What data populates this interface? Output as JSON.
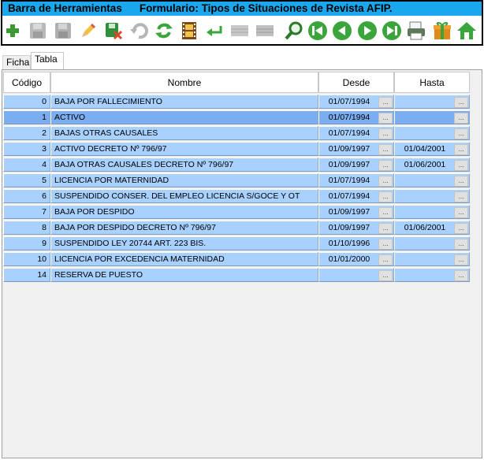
{
  "toolbar": {
    "title": "Barra de Herramientas",
    "form_title": "Formulario: Tipos de Situaciones de Revista AFIP.",
    "buttons": [
      {
        "name": "add-icon"
      },
      {
        "name": "save-icon"
      },
      {
        "name": "save-as-icon"
      },
      {
        "name": "edit-pencil-icon"
      },
      {
        "name": "delete-icon"
      },
      {
        "name": "undo-icon"
      },
      {
        "name": "refresh-icon"
      },
      {
        "name": "film-icon"
      },
      {
        "name": "return-icon"
      },
      {
        "name": "grid-icon-1"
      },
      {
        "name": "grid-icon-2"
      },
      {
        "name": "search-icon"
      },
      {
        "name": "first-record-icon"
      },
      {
        "name": "previous-record-icon"
      },
      {
        "name": "next-record-icon"
      },
      {
        "name": "last-record-icon"
      },
      {
        "name": "print-icon"
      },
      {
        "name": "gift-icon"
      },
      {
        "name": "home-icon"
      }
    ]
  },
  "tabs": [
    {
      "label": "Ficha",
      "active": false
    },
    {
      "label": "Tabla",
      "active": true
    }
  ],
  "table": {
    "columns": [
      "Código",
      "Nombre",
      "Desde",
      "Hasta"
    ],
    "ellipsis": "...",
    "rows": [
      {
        "code": "0",
        "name": "BAJA POR FALLECIMIENTO",
        "desde": "01/07/1994",
        "hasta": ""
      },
      {
        "code": "1",
        "name": "ACTIVO",
        "desde": "01/07/1994",
        "hasta": "",
        "selected": true
      },
      {
        "code": "2",
        "name": "BAJAS OTRAS CAUSALES",
        "desde": "01/07/1994",
        "hasta": ""
      },
      {
        "code": "3",
        "name": "ACTIVO DECRETO Nº 796/97",
        "desde": "01/09/1997",
        "hasta": "01/04/2001"
      },
      {
        "code": "4",
        "name": "BAJA OTRAS CAUSALES DECRETO Nº 796/97",
        "desde": "01/09/1997",
        "hasta": "01/06/2001"
      },
      {
        "code": "5",
        "name": "LICENCIA POR MATERNIDAD",
        "desde": "01/07/1994",
        "hasta": ""
      },
      {
        "code": "6",
        "name": "SUSPENDIDO CONSER. DEL EMPLEO LICENCIA S/GOCE Y OT",
        "desde": "01/07/1994",
        "hasta": ""
      },
      {
        "code": "7",
        "name": "BAJA POR DESPIDO",
        "desde": "01/09/1997",
        "hasta": ""
      },
      {
        "code": "8",
        "name": "BAJA POR DESPIDO DECRETO Nº 796/97",
        "desde": "01/09/1997",
        "hasta": "01/06/2001"
      },
      {
        "code": "9",
        "name": "SUSPENDIDO LEY 20744 ART. 223 BIS.",
        "desde": "01/10/1996",
        "hasta": ""
      },
      {
        "code": "10",
        "name": "LICENCIA POR EXCEDENCIA MATERNIDAD",
        "desde": "01/01/2000",
        "hasta": ""
      },
      {
        "code": "14",
        "name": "RESERVA DE PUESTO",
        "desde": "",
        "hasta": ""
      }
    ]
  },
  "colors": {
    "title_bar": "#1aa7ee",
    "row_bg": "#a8d1ff",
    "row_selected_bg": "#7aaef0",
    "panel_bg": "#f0f0f0"
  }
}
